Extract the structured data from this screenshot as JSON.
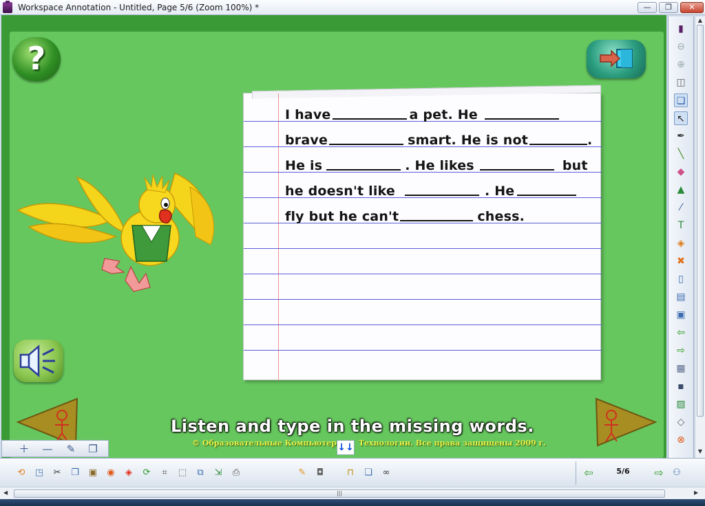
{
  "window": {
    "title": "Workspace Annotation - Untitled, Page 5/6  (Zoom 100%) *",
    "minimize_label": "—",
    "restore_label": "❐",
    "close_label": "✕"
  },
  "slide": {
    "help_label": "?",
    "notebook_lines": {
      "l1": {
        "a": "I have",
        "b": "a pet. He"
      },
      "l2": {
        "a": "brave",
        "b": "smart. He is not",
        "c": "."
      },
      "l3": {
        "a": "He is",
        "b": ". He likes",
        "c": "but"
      },
      "l4": {
        "a": "he  doesn't  like",
        "b": ". He"
      },
      "l5": {
        "a": "fly but he can't",
        "b": "chess."
      }
    },
    "caption": "Listen and type in the missing words.",
    "copyright_left": "©  Образовательные Компьютер",
    "copyright_right": "Технологии. Все права защищены 2009 г.",
    "scroll_marker": "↓↓"
  },
  "bottom_toolbar": {
    "page_indicator": "5/6"
  },
  "colors": {
    "slide_bg": "#66c75e",
    "frame_bg": "#3a9a36",
    "rule_line": "#5c5cd8",
    "margin_line": "#ef8f8f"
  },
  "icons": {
    "right_toolbar": [
      "stop-icon",
      "zoom-out-icon",
      "zoom-in-icon",
      "mouse-icon",
      "copy-page-icon",
      "select-arrow-icon",
      "pen-icon",
      "highlighter-icon",
      "eraser-icon",
      "shapes-icon",
      "line-icon",
      "text-icon",
      "fill-icon",
      "delete-icon",
      "new-page-icon",
      "page-list-icon",
      "screen-capture-icon",
      "back-arrow-icon",
      "forward-arrow-icon",
      "table-icon",
      "save-icon",
      "image-icon",
      "clear-icon",
      "exit-icon"
    ],
    "bottom_toolbar": [
      "open-icon",
      "recent-icon",
      "cut-icon",
      "copy-icon",
      "paste-icon",
      "undo-icon",
      "redo-icon",
      "refresh-icon",
      "crop-icon",
      "select-area-icon",
      "group-icon",
      "export-icon",
      "print-icon",
      "highlight-icon",
      "camera-icon",
      "lock-icon",
      "clone-icon",
      "link-icon",
      "prev-page-icon",
      "next-page-icon",
      "users-icon"
    ]
  }
}
